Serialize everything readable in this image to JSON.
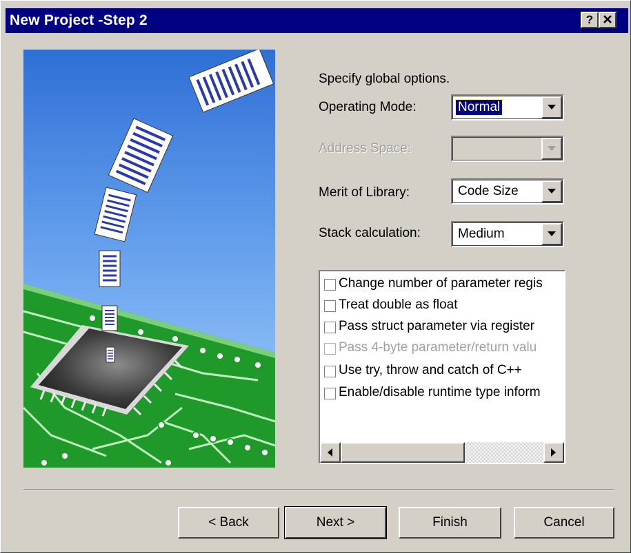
{
  "window": {
    "title": "New Project -Step 2",
    "help_label": "?",
    "close_label": "✕"
  },
  "form": {
    "instruction": "Specify global options.",
    "fields": [
      {
        "label": "Operating Mode:",
        "value": "Normal",
        "enabled": true,
        "focused": true
      },
      {
        "label": "Address Space:",
        "value": "",
        "enabled": false,
        "focused": false
      },
      {
        "label": "Merit of Library:",
        "value": "Code Size",
        "enabled": true,
        "focused": false
      },
      {
        "label": "Stack calculation:",
        "value": "Medium",
        "enabled": true,
        "focused": false
      }
    ]
  },
  "options": {
    "items": [
      {
        "label": "Change number of parameter regis",
        "checked": false,
        "enabled": true
      },
      {
        "label": "Treat double as float",
        "checked": false,
        "enabled": true
      },
      {
        "label": "Pass struct parameter via register",
        "checked": false,
        "enabled": true
      },
      {
        "label": "Pass 4-byte parameter/return valu",
        "checked": false,
        "enabled": false
      },
      {
        "label": "Use try, throw and catch of C++",
        "checked": false,
        "enabled": true
      },
      {
        "label": "Enable/disable runtime type inform",
        "checked": false,
        "enabled": true
      }
    ]
  },
  "buttons": {
    "back": "< Back",
    "next": "Next >",
    "finish": "Finish",
    "cancel": "Cancel"
  },
  "colors": {
    "titlebar": "#000080",
    "dialog_face": "#d4d0c8",
    "sky_top": "#3a78d8",
    "board_green": "#1f9a2a"
  }
}
